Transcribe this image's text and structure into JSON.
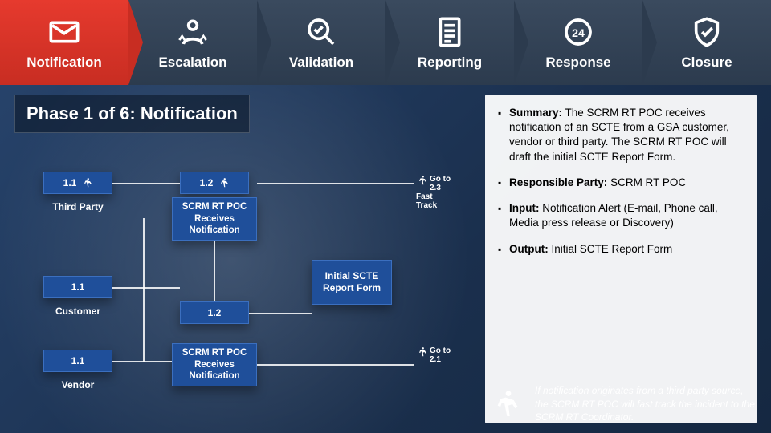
{
  "nav": {
    "steps": [
      {
        "label": "Notification",
        "icon": "mail-icon",
        "active": true
      },
      {
        "label": "Escalation",
        "icon": "person-up-icon"
      },
      {
        "label": "Validation",
        "icon": "magnify-check-icon"
      },
      {
        "label": "Reporting",
        "icon": "doc-lines-icon"
      },
      {
        "label": "Response",
        "icon": "badge-24-icon"
      },
      {
        "label": "Closure",
        "icon": "shield-check-icon"
      }
    ]
  },
  "phase_title": "Phase 1 of 6:  Notification",
  "flow": {
    "tp_num": "1.1",
    "tp_label": "Third Party",
    "tp_desc": "SCRM RT POC Receives Notification",
    "tp_num2": "1.2",
    "tp_goto": "Go to 2.3 Fast Track",
    "cust_num": "1.1",
    "cust_label": "Customer",
    "cust_num2": "1.2",
    "vend_num": "1.1",
    "vend_label": "Vendor",
    "vend_desc": "SCRM RT POC Receives Notification",
    "initial": "Initial SCTE Report Form",
    "goto21": "Go to 2.1"
  },
  "summary": {
    "summary_label": "Summary:",
    "summary_text": "The SCRM RT POC receives notification of an SCTE from a GSA customer, vendor or third party.  The SCRM RT POC will draft the initial SCTE Report Form.",
    "resp_label": "Responsible Party:",
    "resp_text": "SCRM RT POC",
    "input_label": "Input:",
    "input_text": "Notification Alert (E-mail, Phone call, Media press release or Discovery)",
    "output_label": "Output:",
    "output_text": "Initial SCTE Report Form"
  },
  "footer_note": "If notification originates from a third party source, the SCRM RT POC will fast track the incident to the SCRM RT Coordinator."
}
